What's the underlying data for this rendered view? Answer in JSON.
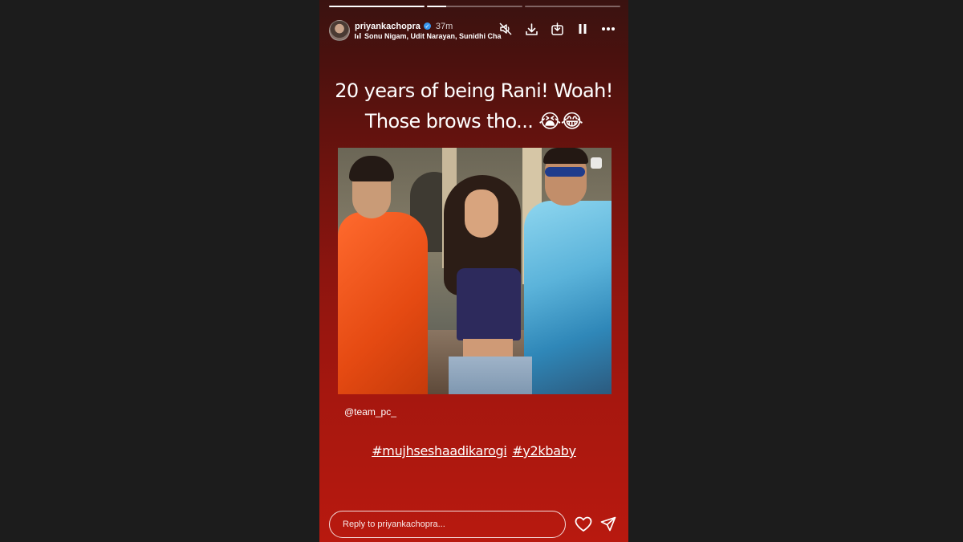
{
  "story": {
    "progress": [
      1.0,
      0.2,
      0.0
    ],
    "username": "priyankachopra",
    "verified": true,
    "time": "37m",
    "music": "Sonu Nigam, Udit Narayan, Sunidhi Cha",
    "caption": {
      "line1": "20 years of being Rani! Woah!",
      "line2": "Those brows tho... 😭😂"
    },
    "mention": "@team_pc_",
    "hashtags": [
      "#mujhseshaadikarogi",
      "#y2kbaby"
    ],
    "reply_placeholder": "Reply to priyankachopra...",
    "background": "#8c150f",
    "verified_color": "#3897f0"
  }
}
